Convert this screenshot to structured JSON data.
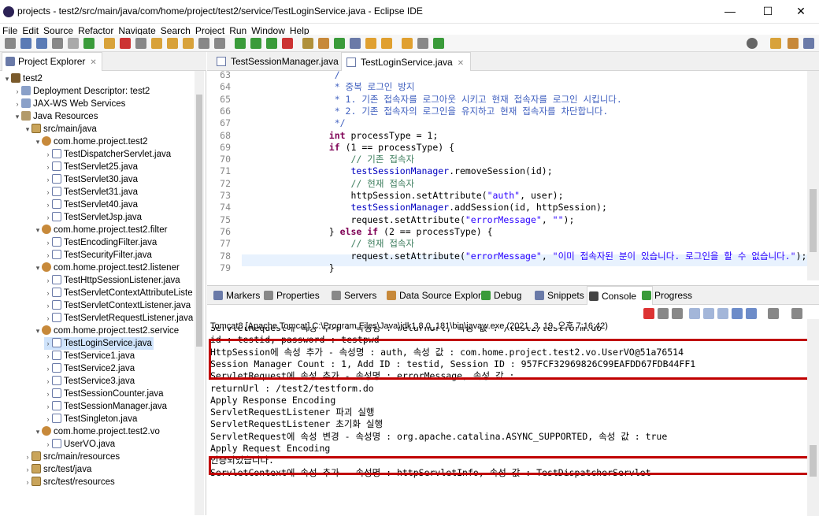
{
  "window": {
    "title": "projects - test2/src/main/java/com/home/project/test2/service/TestLoginService.java - Eclipse IDE",
    "minimize": "—",
    "maximize": "☐",
    "close": "✕"
  },
  "menu": [
    "File",
    "Edit",
    "Source",
    "Refactor",
    "Navigate",
    "Search",
    "Project",
    "Run",
    "Window",
    "Help"
  ],
  "project_explorer": {
    "tab_label": "Project Explorer",
    "items": [
      {
        "label": "test2",
        "level": 0,
        "twist": "▾",
        "icon": "project"
      },
      {
        "label": "Deployment Descriptor: test2",
        "level": 1,
        "twist": "›",
        "icon": "desc"
      },
      {
        "label": "JAX-WS Web Services",
        "level": 1,
        "twist": "›",
        "icon": "desc"
      },
      {
        "label": "Java Resources",
        "level": 1,
        "twist": "▾",
        "icon": "lib"
      },
      {
        "label": "src/main/java",
        "level": 2,
        "twist": "▾",
        "icon": "srcfolder"
      },
      {
        "label": "com.home.project.test2",
        "level": 3,
        "twist": "▾",
        "icon": "pkg"
      },
      {
        "label": "TestDispatcherServlet.java",
        "level": 4,
        "twist": "›",
        "icon": "java"
      },
      {
        "label": "TestServlet25.java",
        "level": 4,
        "twist": "›",
        "icon": "java"
      },
      {
        "label": "TestServlet30.java",
        "level": 4,
        "twist": "›",
        "icon": "java"
      },
      {
        "label": "TestServlet31.java",
        "level": 4,
        "twist": "›",
        "icon": "java"
      },
      {
        "label": "TestServlet40.java",
        "level": 4,
        "twist": "›",
        "icon": "java"
      },
      {
        "label": "TestServletJsp.java",
        "level": 4,
        "twist": "›",
        "icon": "java"
      },
      {
        "label": "com.home.project.test2.filter",
        "level": 3,
        "twist": "▾",
        "icon": "pkg"
      },
      {
        "label": "TestEncodingFilter.java",
        "level": 4,
        "twist": "›",
        "icon": "java"
      },
      {
        "label": "TestSecurityFilter.java",
        "level": 4,
        "twist": "›",
        "icon": "java"
      },
      {
        "label": "com.home.project.test2.listener",
        "level": 3,
        "twist": "▾",
        "icon": "pkg"
      },
      {
        "label": "TestHttpSessionListener.java",
        "level": 4,
        "twist": "›",
        "icon": "java"
      },
      {
        "label": "TestServletContextAttributeListe",
        "level": 4,
        "twist": "›",
        "icon": "java"
      },
      {
        "label": "TestServletContextListener.java",
        "level": 4,
        "twist": "›",
        "icon": "java"
      },
      {
        "label": "TestServletRequestListener.java",
        "level": 4,
        "twist": "›",
        "icon": "java"
      },
      {
        "label": "com.home.project.test2.service",
        "level": 3,
        "twist": "▾",
        "icon": "pkg"
      },
      {
        "label": "TestLoginService.java",
        "level": 4,
        "twist": "›",
        "icon": "java",
        "selected": true
      },
      {
        "label": "TestService1.java",
        "level": 4,
        "twist": "›",
        "icon": "java"
      },
      {
        "label": "TestService2.java",
        "level": 4,
        "twist": "›",
        "icon": "java"
      },
      {
        "label": "TestService3.java",
        "level": 4,
        "twist": "›",
        "icon": "java"
      },
      {
        "label": "TestSessionCounter.java",
        "level": 4,
        "twist": "›",
        "icon": "java"
      },
      {
        "label": "TestSessionManager.java",
        "level": 4,
        "twist": "›",
        "icon": "java"
      },
      {
        "label": "TestSingleton.java",
        "level": 4,
        "twist": "›",
        "icon": "java"
      },
      {
        "label": "com.home.project.test2.vo",
        "level": 3,
        "twist": "▾",
        "icon": "pkg"
      },
      {
        "label": "UserVO.java",
        "level": 4,
        "twist": "›",
        "icon": "java"
      },
      {
        "label": "src/main/resources",
        "level": 2,
        "twist": "›",
        "icon": "srcfolder"
      },
      {
        "label": "src/test/java",
        "level": 2,
        "twist": "›",
        "icon": "srcfolder"
      },
      {
        "label": "src/test/resources",
        "level": 2,
        "twist": "›",
        "icon": "srcfolder"
      }
    ]
  },
  "editor": {
    "tabs": [
      {
        "label": "TestSessionManager.java",
        "active": false
      },
      {
        "label": "TestLoginService.java",
        "active": true
      }
    ],
    "lines": [
      {
        "n": "63",
        "tokens": [
          {
            "t": "                 /",
            "c": "c-cm"
          }
        ]
      },
      {
        "n": "64",
        "tokens": [
          {
            "t": "                 * 중복 로그인 방지",
            "c": "c-cm"
          }
        ]
      },
      {
        "n": "65",
        "tokens": [
          {
            "t": "                 * 1. 기존 접속자를 로그아웃 시키고 현재 접속자를 로그인 시킵니다.",
            "c": "c-cm"
          }
        ]
      },
      {
        "n": "66",
        "tokens": [
          {
            "t": "                 * 2. 기존 접속자의 로그인을 유지하고 현재 접속자를 차단합니다.",
            "c": "c-cm"
          }
        ]
      },
      {
        "n": "67",
        "tokens": [
          {
            "t": "                 */",
            "c": "c-cm"
          }
        ]
      },
      {
        "n": "68",
        "tokens": [
          {
            "t": "                ",
            "c": ""
          },
          {
            "t": "int",
            "c": "c-kw"
          },
          {
            "t": " processType = 1;",
            "c": ""
          }
        ]
      },
      {
        "n": "69",
        "tokens": [
          {
            "t": "                ",
            "c": ""
          },
          {
            "t": "if",
            "c": "c-kw"
          },
          {
            "t": " (1 == processType) {",
            "c": ""
          }
        ]
      },
      {
        "n": "70",
        "tokens": [
          {
            "t": "                    // 기존 접속자",
            "c": "c-lc"
          }
        ]
      },
      {
        "n": "71",
        "tokens": [
          {
            "t": "                    ",
            "c": ""
          },
          {
            "t": "testSessionManager",
            "c": "c-var"
          },
          {
            "t": ".removeSession(id);",
            "c": ""
          }
        ]
      },
      {
        "n": "72",
        "tokens": [
          {
            "t": "                    // 현재 접속자",
            "c": "c-lc"
          }
        ]
      },
      {
        "n": "73",
        "tokens": [
          {
            "t": "                    httpSession.setAttribute(",
            "c": ""
          },
          {
            "t": "\"auth\"",
            "c": "c-str"
          },
          {
            "t": ", user);",
            "c": ""
          }
        ]
      },
      {
        "n": "74",
        "tokens": [
          {
            "t": "                    ",
            "c": ""
          },
          {
            "t": "testSessionManager",
            "c": "c-var"
          },
          {
            "t": ".addSession(id, httpSession);",
            "c": ""
          }
        ]
      },
      {
        "n": "75",
        "tokens": [
          {
            "t": "                    request.setAttribute(",
            "c": ""
          },
          {
            "t": "\"errorMessage\"",
            "c": "c-str"
          },
          {
            "t": ", ",
            "c": ""
          },
          {
            "t": "\"\"",
            "c": "c-str"
          },
          {
            "t": ");",
            "c": ""
          }
        ]
      },
      {
        "n": "76",
        "tokens": [
          {
            "t": "                } ",
            "c": ""
          },
          {
            "t": "else if",
            "c": "c-kw"
          },
          {
            "t": " (2 == processType) {",
            "c": ""
          }
        ]
      },
      {
        "n": "77",
        "tokens": [
          {
            "t": "                    // 현재 접속자",
            "c": "c-lc"
          }
        ]
      },
      {
        "n": "78",
        "tokens": [
          {
            "t": "                    request.setAttribute(",
            "c": ""
          },
          {
            "t": "\"errorMessage\"",
            "c": "c-str"
          },
          {
            "t": ", ",
            "c": ""
          },
          {
            "t": "\"이미 접속자된 분이 있습니다. 로그인을 할 수 없습니다.\"",
            "c": "c-str"
          },
          {
            "t": ");",
            "c": ""
          }
        ]
      },
      {
        "n": "79",
        "tokens": [
          {
            "t": "                }",
            "c": ""
          }
        ]
      }
    ]
  },
  "console": {
    "tabs": [
      {
        "label": "Markers",
        "active": false
      },
      {
        "label": "Properties",
        "active": false
      },
      {
        "label": "Servers",
        "active": false
      },
      {
        "label": "Data Source Explorer",
        "active": false
      },
      {
        "label": "Debug",
        "active": false
      },
      {
        "label": "Snippets",
        "active": false
      },
      {
        "label": "Console",
        "active": true
      },
      {
        "label": "Progress",
        "active": false
      }
    ],
    "description": "Tomcat8 [Apache Tomcat] C:\\Program Files\\Java\\jdk1.8.0_181\\bin\\javaw.exe  (2021. 3. 19. 오후 7:16:42)",
    "lines": [
      "ServletRequest에 속성 추가 - 속성명 : returnUrl, 속성 값 : /test2/testform.do",
      "id : testid, password : testpwd",
      "HttpSession에 속성 추가 - 속성명 : auth, 속성 값 : com.home.project.test2.vo.UserVO@51a76514",
      "Session Manager Count : 1, Add ID : testid, Session ID : 957FCF32969826C99EAFDD67FDB44FF1",
      "ServletRequest에 속성 추가 - 속성명 : errorMessage, 속성 값 :",
      "returnUrl : /test2/testform.do",
      "Apply Response Encoding",
      "ServletRequestListener 파괴 실행",
      "ServletRequestListener 초기화 실행",
      "ServletRequest에 속성 변경 - 속성명 : org.apache.catalina.ASYNC_SUPPORTED, 속성 값 : true",
      "Apply Request Encoding",
      "인증되었습니다.",
      "ServletContext에 속성 추가 - 속성명 : httpServletInfo, 속성 값 : TestDispatcherServlet"
    ]
  },
  "colors": {
    "highlight_box": "#c00000",
    "keyword": "#7f0055",
    "string": "#2a00ff",
    "comment": "#3f5fbf"
  }
}
